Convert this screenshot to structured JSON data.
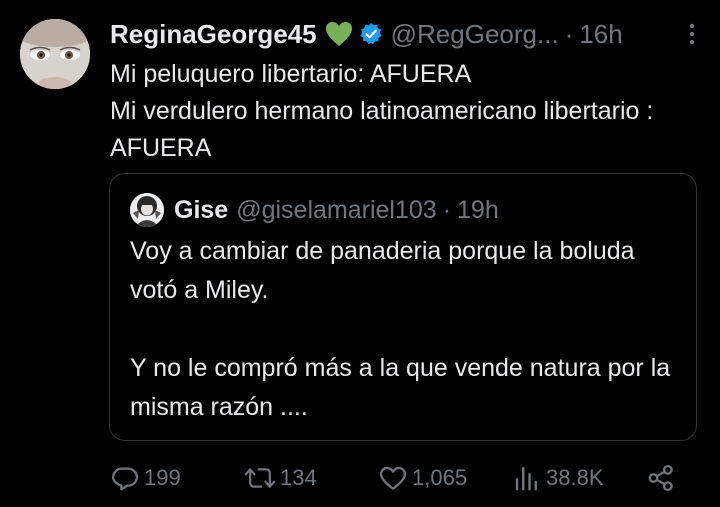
{
  "tweet": {
    "author_name": "ReginaGeorge45",
    "handle": "@RegGeorg...",
    "separator": "·",
    "time": "16h",
    "text": "Mi peluquero libertario: AFUERA\nMi verdulero hermano latinoamericano libertario : AFUERA"
  },
  "quoted_tweet": {
    "author_name": "Gise",
    "handle": "@giselamariel103",
    "separator": "·",
    "time": "19h",
    "text": "Voy a cambiar de panaderia porque la boluda votó a Miley.\n\nY no le compró más a la que vende natura por la misma razón ...."
  },
  "actions": {
    "replies": "199",
    "reposts": "134",
    "likes": "1,065",
    "views": "38.8K"
  },
  "icons": {
    "heart_emoji": "green-heart-icon",
    "verified": "verified-badge-icon",
    "more": "more-options-icon",
    "reply": "reply-icon",
    "repost": "repost-icon",
    "like": "like-icon",
    "views": "views-icon",
    "share": "share-icon"
  },
  "colors": {
    "background": "#000000",
    "text": "#e7e9ea",
    "muted": "#71767b",
    "verified": "#1d9bf0",
    "heart": "#78b159",
    "border": "#2f3336"
  }
}
